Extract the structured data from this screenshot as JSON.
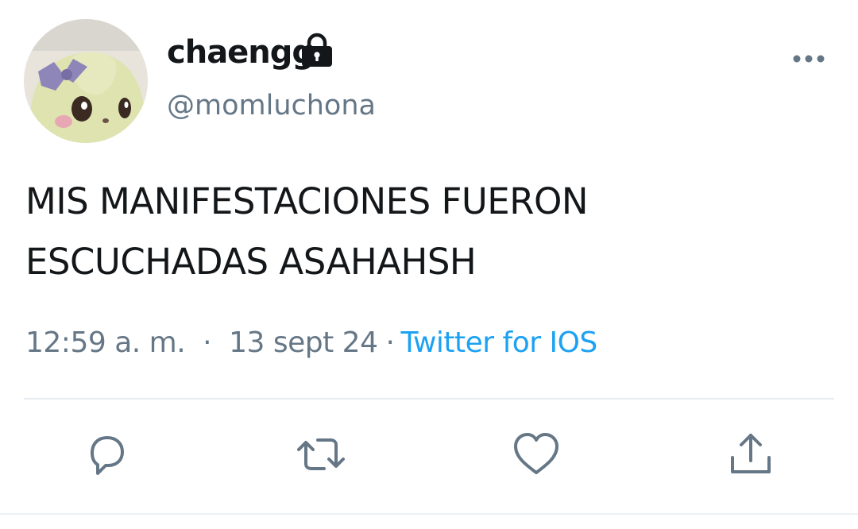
{
  "tweet": {
    "display_name": "chaengg",
    "handle": "@momluchona",
    "text_lines": [
      "MIS MANIFESTACIONES FUERON",
      "ESCUCHADAS ASAHAHSH"
    ],
    "time": "12:59 a. m.",
    "separator": "·",
    "date": "13 sept 24",
    "source": "Twitter for IOS",
    "protected_icon": "lock-icon"
  },
  "actions": {
    "icons": [
      "reply-icon",
      "retweet-icon",
      "like-icon",
      "share-icon"
    ]
  },
  "colors": {
    "text": "#14171a",
    "secondary": "#657786",
    "link": "#1da1f2",
    "divider": "#e6ecf0"
  }
}
